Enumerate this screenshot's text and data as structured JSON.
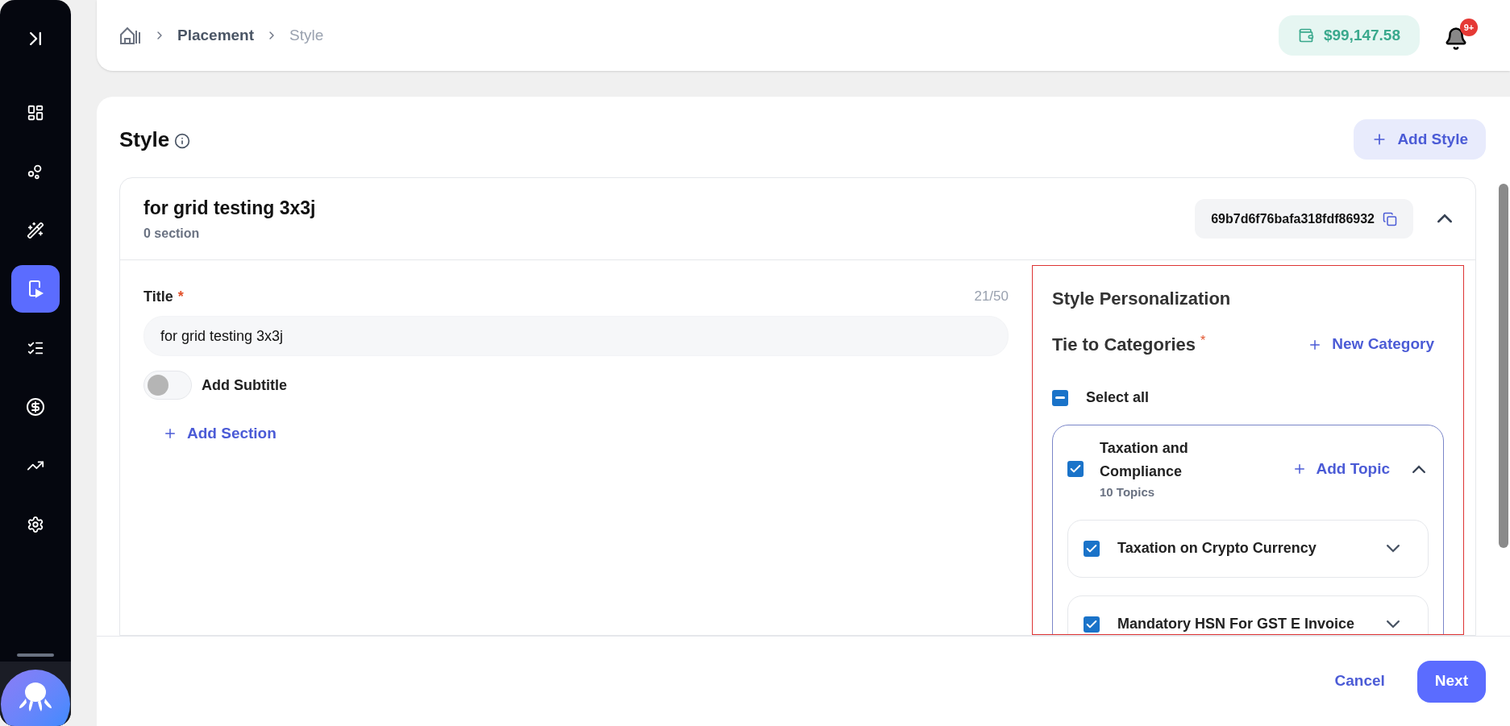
{
  "sidebar": {
    "items": [
      {
        "selected": false
      },
      {
        "selected": false
      },
      {
        "selected": false
      },
      {
        "selected": true
      },
      {
        "selected": false
      },
      {
        "selected": false
      },
      {
        "selected": false
      },
      {
        "selected": false
      }
    ]
  },
  "breadcrumb": [
    "Placement",
    "Style"
  ],
  "wallet": {
    "balance": "$99,147.58"
  },
  "notifications": {
    "badge": "9+"
  },
  "page": {
    "title": "Style",
    "add_button": "Add Style"
  },
  "style_card": {
    "title": "for grid testing 3x3j",
    "subtitle": "0 section",
    "id": "69b7d6f76bafa318fdf86932",
    "expanded": true,
    "form": {
      "title_label": "Title",
      "required": "*",
      "counter": "21/50",
      "title_value": "for grid testing 3x3j",
      "subtitle_toggle": {
        "label": "Add Subtitle",
        "on": false
      },
      "add_section": "Add Section"
    },
    "personalization": {
      "heading": "Style Personalization",
      "categories_label": "Tie to Categories",
      "required": "*",
      "new_category": "New Category",
      "select_all": {
        "label": "Select all",
        "partial": true
      },
      "categories": [
        {
          "name": "Taxation and Compliance",
          "count": "10 Topics",
          "checked": true,
          "expanded": true,
          "add_topic": "Add Topic",
          "topics": [
            {
              "name": "Taxation on Crypto Currency",
              "checked": true,
              "expanded": false
            },
            {
              "name": "Mandatory HSN For GST E Invoice",
              "checked": true,
              "expanded": false
            }
          ]
        }
      ]
    }
  },
  "footer": {
    "cancel": "Cancel",
    "next": "Next"
  }
}
